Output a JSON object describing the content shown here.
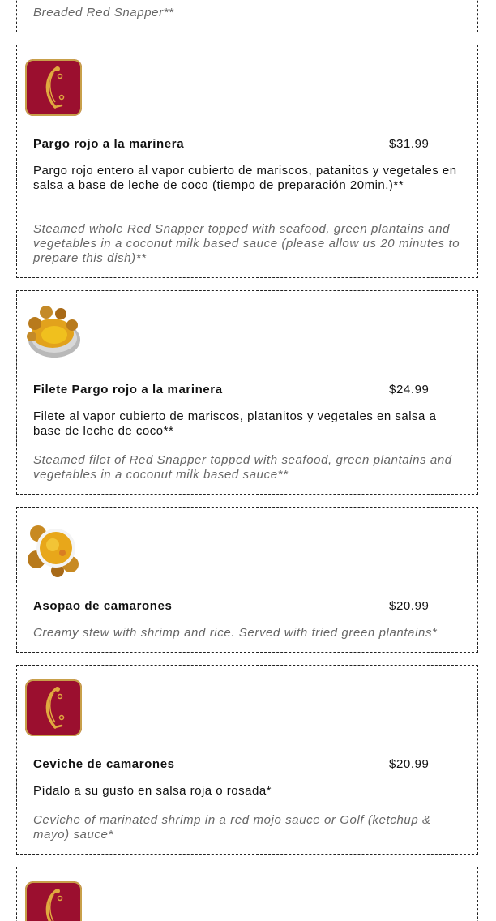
{
  "items": [
    {
      "en": "Breaded Red Snapper**"
    },
    {
      "thumb": "logo-icon",
      "name": "Pargo rojo a la marinera",
      "price": "$31.99",
      "es": "Pargo rojo entero al vapor cubierto de mariscos, patanitos y vegetales en salsa a base de leche de coco (tiempo de preparación 20min.)**",
      "en": "Steamed whole Red Snapper topped with seafood, green plantains and vegetables in a coconut milk based sauce (please allow us 20 minutes to prepare this dish)**"
    },
    {
      "thumb": "fish-dish-photo",
      "name": "Filete Pargo rojo a la marinera",
      "price": "$24.99",
      "es": "Filete al vapor cubierto de mariscos, platanitos y vegetales en salsa a base de leche de coco**",
      "en": "Steamed filet of Red Snapper topped with seafood, green plantains and vegetables in a coconut milk based sauce**"
    },
    {
      "thumb": "stew-dish-photo",
      "name": "Asopao de camarones",
      "price": "$20.99",
      "en": "Creamy stew with shrimp and rice. Served with fried green plantains*"
    },
    {
      "thumb": "logo-icon",
      "name": "Ceviche de camarones",
      "price": "$20.99",
      "es": "Pídalo a su gusto en salsa roja o rosada*",
      "en": "Ceviche of marinated shrimp in a red mojo sauce or Golf (ketchup & mayo) sauce*"
    },
    {
      "thumb": "logo-icon"
    }
  ],
  "colors": {
    "logo_background": "#9b0f2f",
    "logo_gold": "#e0a93f",
    "english_text": "#666666",
    "card_border": "#222222"
  }
}
